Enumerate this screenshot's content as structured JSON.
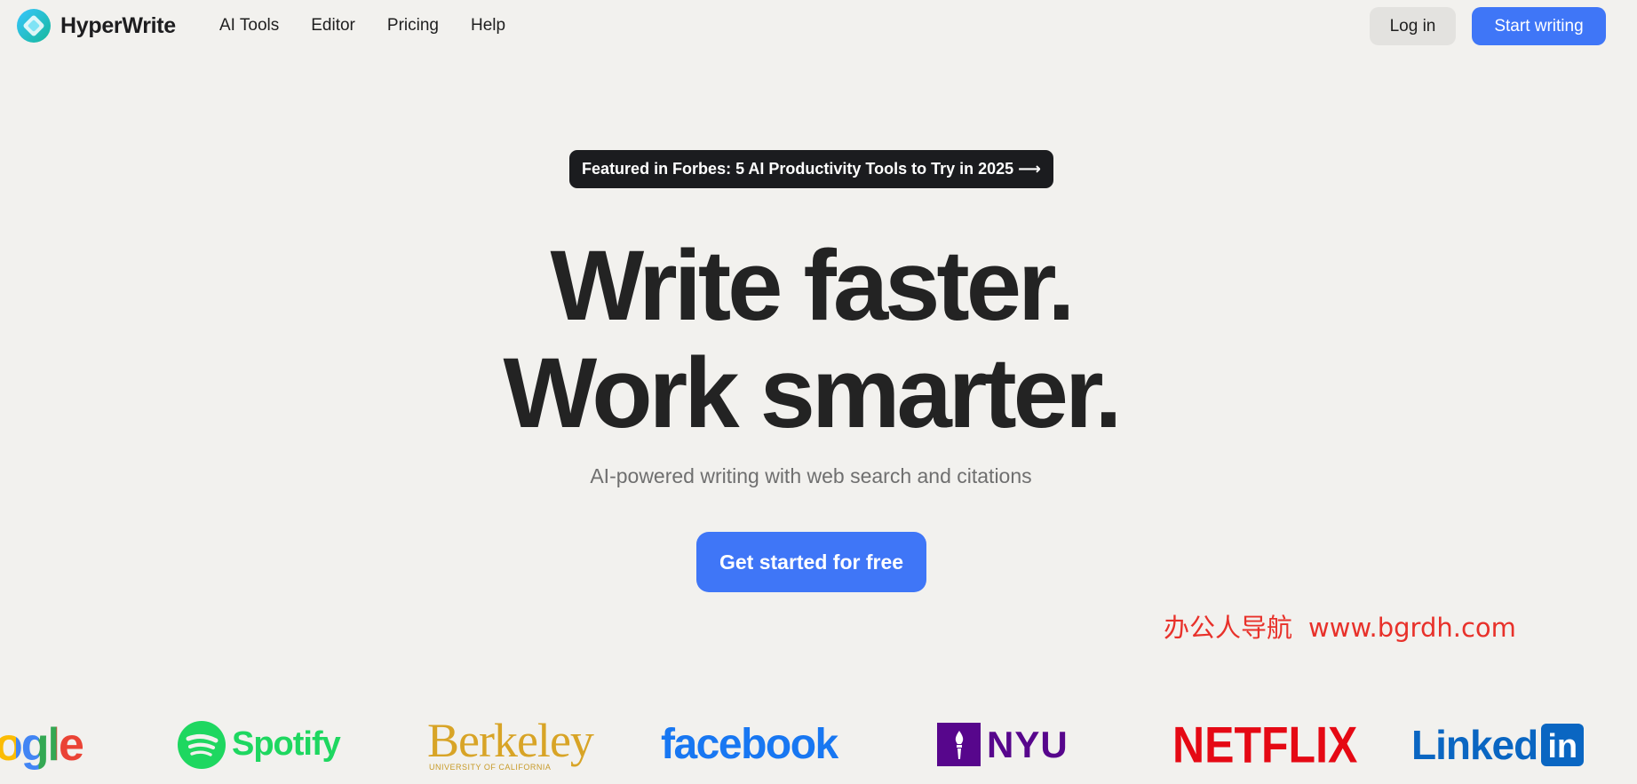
{
  "header": {
    "brand_name": "HyperWrite",
    "nav": [
      "AI Tools",
      "Editor",
      "Pricing",
      "Help"
    ],
    "login_label": "Log in",
    "start_label": "Start writing"
  },
  "hero": {
    "announcement": "Featured in Forbes: 5 AI Productivity Tools to Try in 2025 ⟶",
    "title_line1": "Write faster.",
    "title_line2": "Work smarter.",
    "subtitle": "AI-powered writing with web search and citations",
    "cta_label": "Get started for free"
  },
  "watermark": {
    "text_cn": "办公人导航",
    "url": "www.bgrdh.com"
  },
  "logos": {
    "google_partial": "ogle",
    "spotify": "Spotify",
    "berkeley": "Berkeley",
    "berkeley_sub": "UNIVERSITY OF CALIFORNIA",
    "facebook": "facebook",
    "nyu": "NYU",
    "netflix": "NETFLIX",
    "linkedin_word": "Linked",
    "linkedin_in": "in"
  },
  "colors": {
    "background": "#f2f1ee",
    "accent_blue": "#3f76f7",
    "dark_pill": "#1b1c1f",
    "watermark_red": "#e8312a"
  }
}
